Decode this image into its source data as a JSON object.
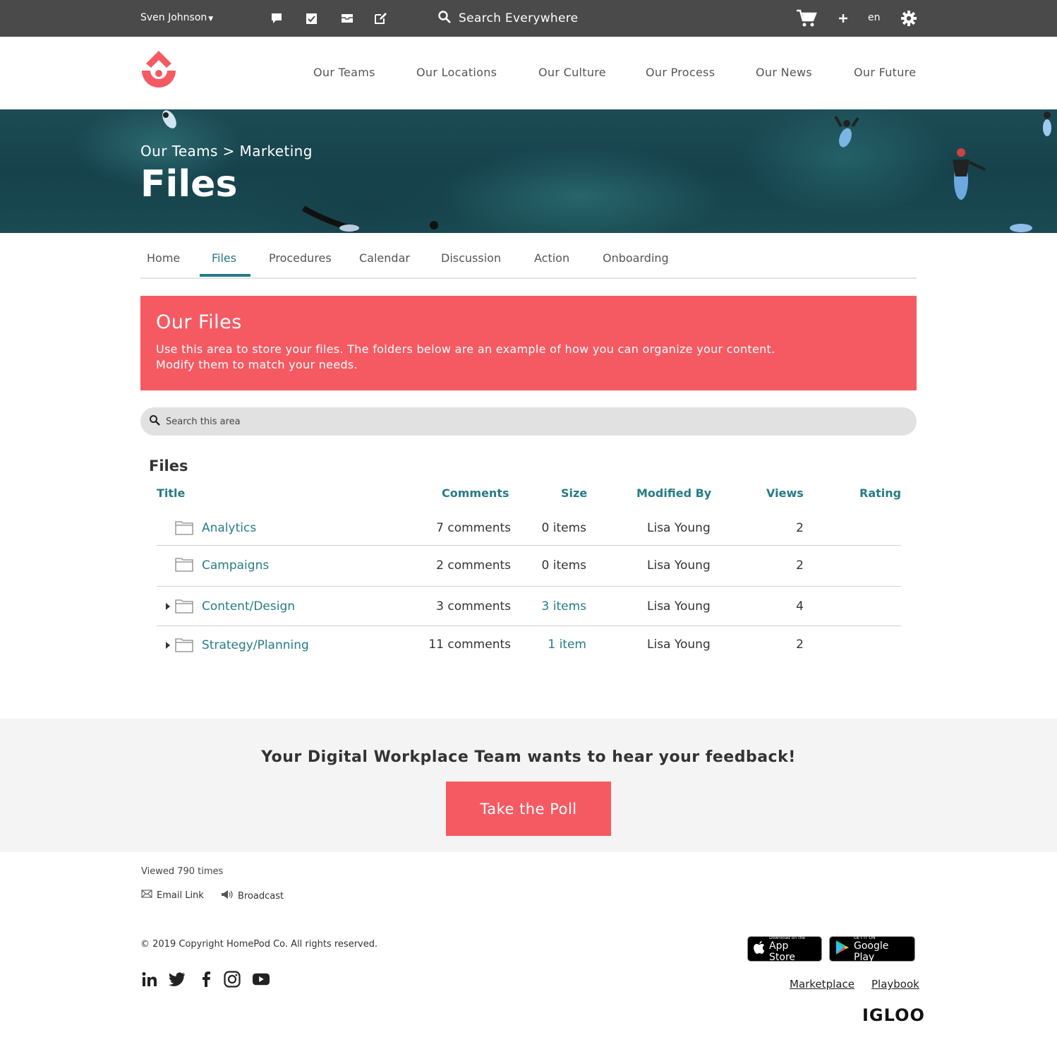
{
  "topbar": {
    "user_name": "Sven Johnson",
    "search_label": "Search Everywhere",
    "language": "en",
    "icons": [
      "chat-icon",
      "checkbox-icon",
      "inbox-icon",
      "compose-icon",
      "search-icon",
      "cart-icon",
      "plus-icon",
      "gear-icon"
    ]
  },
  "nav": {
    "items": [
      "Our Teams",
      "Our Locations",
      "Our Culture",
      "Our Process",
      "Our News",
      "Our Future"
    ]
  },
  "hero": {
    "breadcrumb": "Our Teams > Marketing",
    "title": "Files"
  },
  "tabs": {
    "items": [
      "Home",
      "Files",
      "Procedures",
      "Calendar",
      "Discussion",
      "Action",
      "Onboarding"
    ],
    "active": "Files"
  },
  "banner": {
    "title": "Our Files",
    "line1": "Use this area to store your files. The folders below are an example of how you can organize your content.",
    "line2": "Modify them to match your needs."
  },
  "area_search": {
    "placeholder": "Search this area"
  },
  "files": {
    "heading": "Files",
    "columns": {
      "title": "Title",
      "comments": "Comments",
      "size": "Size",
      "modified_by": "Modified By",
      "views": "Views",
      "rating": "Rating"
    },
    "rows": [
      {
        "title": "Analytics",
        "comments": "7 comments",
        "size": "0 items",
        "modified_by": "Lisa Young",
        "views": "2"
      },
      {
        "title": "Campaigns",
        "comments": "2 comments",
        "size": "0 items",
        "modified_by": "Lisa Young",
        "views": "2"
      },
      {
        "title": "Content/Design",
        "comments": "3 comments",
        "size": "3 items",
        "modified_by": "Lisa Young",
        "views": "4"
      },
      {
        "title": "Strategy/Planning",
        "comments": "11 comments",
        "size": "1 item",
        "modified_by": "Lisa Young",
        "views": "2"
      }
    ]
  },
  "feedback": {
    "heading": "Your Digital Workplace Team wants to hear your feedback!",
    "button": "Take the Poll"
  },
  "footer": {
    "viewed": "Viewed 790 times",
    "email_link": "Email Link",
    "broadcast": "Broadcast",
    "copyright": "© 2019 Copyright HomePod Co. All rights reserved.",
    "social_icons": [
      "linkedin-icon",
      "twitter-icon",
      "facebook-icon",
      "instagram-icon",
      "youtube-icon"
    ],
    "app_store_small": "Download on the",
    "app_store_big": "App Store",
    "google_play_small": "GET IT ON",
    "google_play_big": "Google Play",
    "marketplace": "Marketplace",
    "playbook": "Playbook",
    "brand": "IGLOO"
  },
  "colors": {
    "topbar": "#4a4a4a",
    "accent_teal": "#267c86",
    "brand_coral": "#f55a63",
    "feedback_bg": "#f4f4f4"
  }
}
